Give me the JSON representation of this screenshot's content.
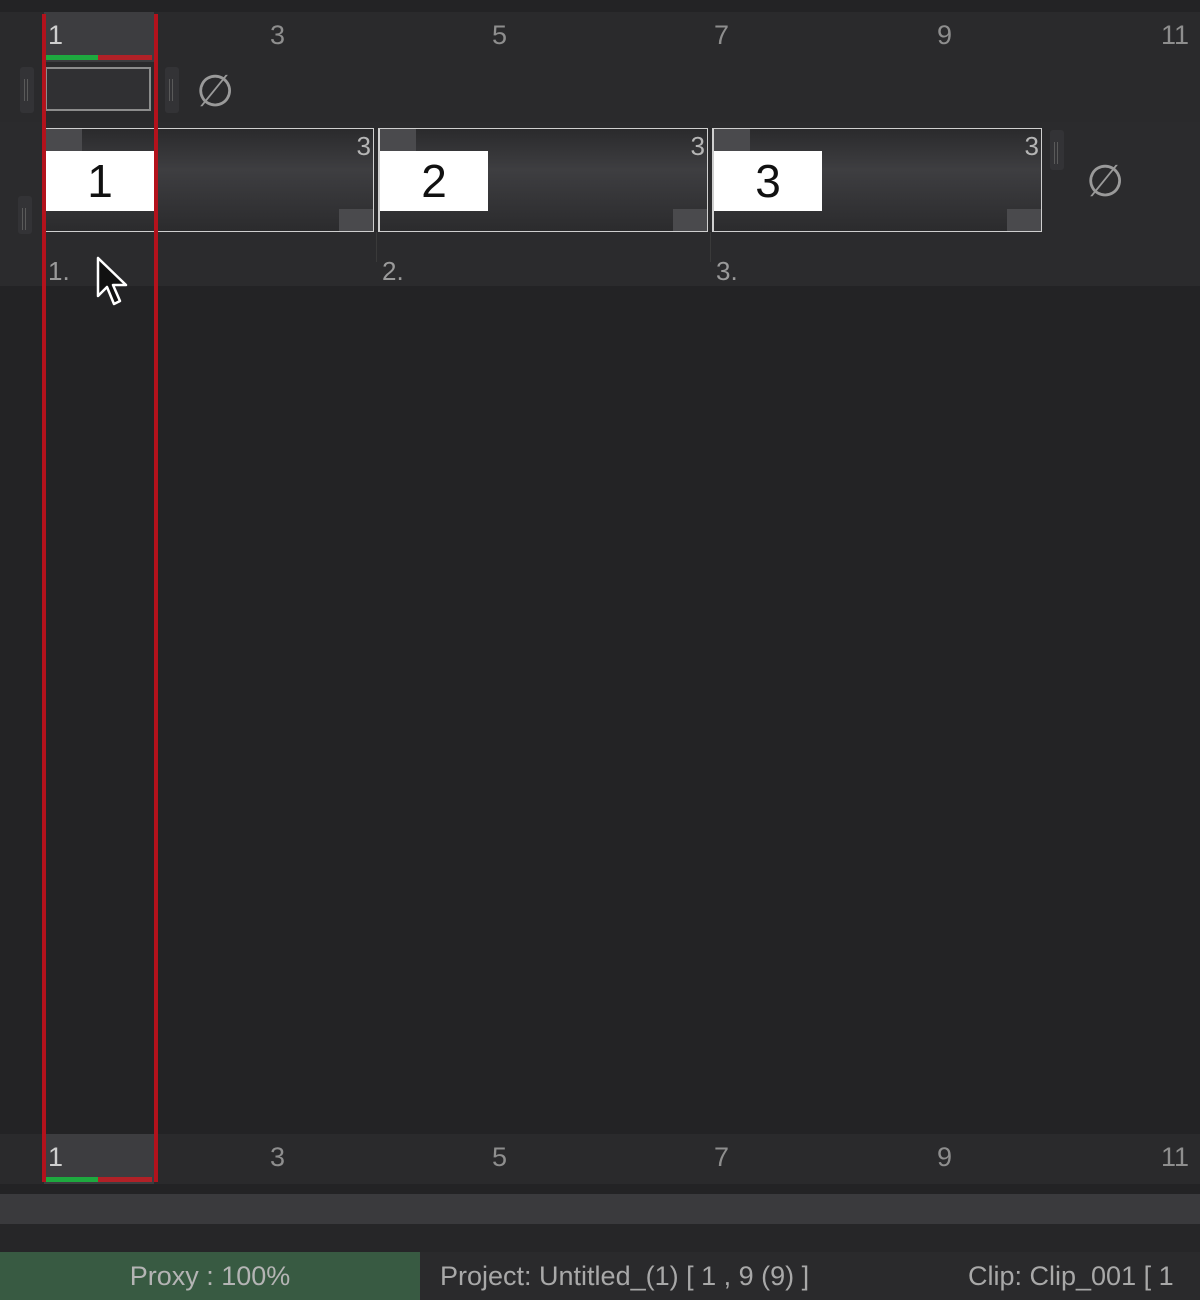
{
  "ruler": {
    "ticks": [
      "1",
      "3",
      "5",
      "7",
      "9",
      "11"
    ]
  },
  "empty_symbol": "∅",
  "clips": [
    {
      "number": "1",
      "duration": "3",
      "label": "1."
    },
    {
      "number": "2",
      "duration": "3",
      "label": "2."
    },
    {
      "number": "3",
      "duration": "3",
      "label": "3."
    }
  ],
  "status": {
    "proxy": "Proxy : 100%",
    "project": "Project: Untitled_(1) [ 1 , 9  (9) ]",
    "clip": "Clip: Clip_001 [ 1"
  },
  "colors": {
    "playhead": "#b3121c",
    "proxy_bg": "#385a42",
    "in_range": "#1ea93f",
    "out_range": "#b12127"
  }
}
